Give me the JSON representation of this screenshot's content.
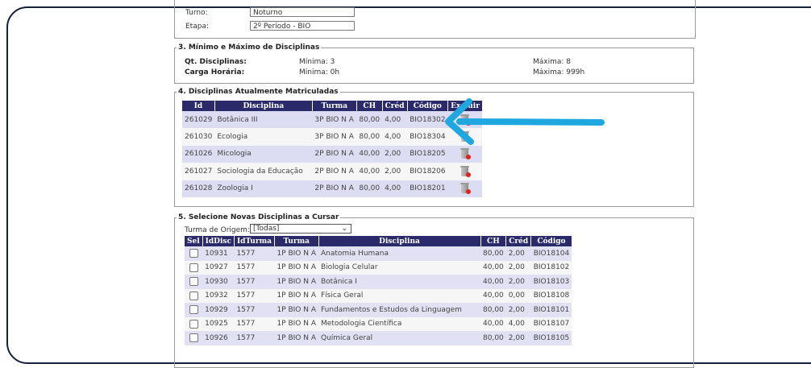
{
  "student": {
    "turno_label": "Turno:",
    "turno_value": "Noturno",
    "etapa_label": "Etapa:",
    "etapa_value": "2º Período - BIO"
  },
  "limits": {
    "legend": "3. Mínimo e Máximo de Disciplinas",
    "qt_label": "Qt. Disciplinas:",
    "qt_min": "Mínima: 3",
    "qt_max": "Máxima: 8",
    "ch_label": "Carga Horária:",
    "ch_min": "Mínima: 0h",
    "ch_max": "Máxima: 999h"
  },
  "enrolled": {
    "legend": "4. Disciplinas Atualmente Matriculadas",
    "columns": [
      "Id",
      "Disciplina",
      "Turma",
      "CH",
      "Créd",
      "Código",
      "Excluir"
    ],
    "rows": [
      {
        "id": "261029",
        "disciplina": "Botânica III",
        "turma": "3P BIO N A",
        "ch": "80,00",
        "cred": "4,00",
        "codigo": "BIO18302"
      },
      {
        "id": "261030",
        "disciplina": "Ecologia",
        "turma": "3P BIO N A",
        "ch": "80,00",
        "cred": "4,00",
        "codigo": "BIO18304"
      },
      {
        "id": "261026",
        "disciplina": "Micologia",
        "turma": "2P BIO N A",
        "ch": "40,00",
        "cred": "2,00",
        "codigo": "BIO18205"
      },
      {
        "id": "261027",
        "disciplina": "Sociologia da Educação",
        "turma": "2P BIO N A",
        "ch": "40,00",
        "cred": "2,00",
        "codigo": "BIO18206"
      },
      {
        "id": "261028",
        "disciplina": "Zoologia I",
        "turma": "2P BIO N A",
        "ch": "80,00",
        "cred": "4,00",
        "codigo": "BIO18201"
      }
    ]
  },
  "new_courses": {
    "legend": "5. Selecione Novas Disciplinas a Cursar",
    "origin_label": "Turma de Origem:",
    "origin_value": "[Todas]",
    "columns": [
      "Sel",
      "IdDisc",
      "IdTurma",
      "Turma",
      "Disciplina",
      "CH",
      "Créd",
      "Código"
    ],
    "rows": [
      {
        "iddisc": "10931",
        "idturma": "1577",
        "turma": "1P BIO N A",
        "disciplina": "Anatomia Humana",
        "ch": "80,00",
        "cred": "2,00",
        "codigo": "BIO18104"
      },
      {
        "iddisc": "10927",
        "idturma": "1577",
        "turma": "1P BIO N A",
        "disciplina": "Biologia Celular",
        "ch": "40,00",
        "cred": "2,00",
        "codigo": "BIO18102"
      },
      {
        "iddisc": "10930",
        "idturma": "1577",
        "turma": "1P BIO N A",
        "disciplina": "Botânica I",
        "ch": "40,00",
        "cred": "2,00",
        "codigo": "BIO18103"
      },
      {
        "iddisc": "10932",
        "idturma": "1577",
        "turma": "1P BIO N A",
        "disciplina": "Física Geral",
        "ch": "40,00",
        "cred": "0,00",
        "codigo": "BIO18108"
      },
      {
        "iddisc": "10929",
        "idturma": "1577",
        "turma": "1P BIO N A",
        "disciplina": "Fundamentos e Estudos da Linguagem",
        "ch": "80,00",
        "cred": "2,00",
        "codigo": "BIO18101"
      },
      {
        "iddisc": "10925",
        "idturma": "1577",
        "turma": "1P BIO N A",
        "disciplina": "Metodologia Científica",
        "ch": "40,00",
        "cred": "4,00",
        "codigo": "BIO18107"
      },
      {
        "iddisc": "10926",
        "idturma": "1577",
        "turma": "1P BIO N A",
        "disciplina": "Química Geral",
        "ch": "80,00",
        "cred": "2,00",
        "codigo": "BIO18105"
      }
    ]
  },
  "colors": {
    "header_bg": "#2a2a6a",
    "arrow": "#1fa8e0",
    "frame": "#16213a"
  },
  "icons": {
    "delete": "trash-can-delete-icon",
    "annotation": "pointer-arrow-icon"
  }
}
